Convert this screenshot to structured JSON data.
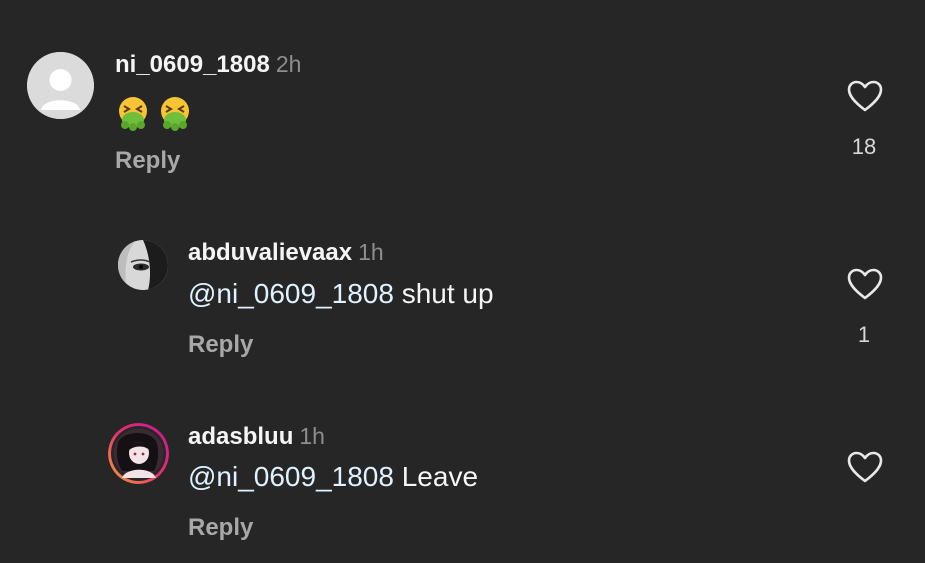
{
  "comments": [
    {
      "username": "ni_0609_1808",
      "time": "2h",
      "text": "🤮🤮",
      "reply_label": "Reply",
      "like_count": "18",
      "avatar_icon": "default-avatar-icon"
    },
    {
      "username": "abduvalievaax",
      "time": "1h",
      "mention": "@ni_0609_1808",
      "text": " shut up",
      "reply_label": "Reply",
      "like_count": "1",
      "avatar_icon": "user-photo-avatar"
    },
    {
      "username": "adasbluu",
      "time": "1h",
      "mention": "@ni_0609_1808",
      "text": " Leave",
      "reply_label": "Reply",
      "like_count": "",
      "avatar_icon": "story-ring-avatar"
    }
  ],
  "icons": {
    "like": "heart-outline-icon"
  },
  "colors": {
    "background": "#262626",
    "username": "#f5f5f5",
    "time": "#8e8e8e",
    "reply": "#a8a8a8",
    "mention": "#e0f1ff",
    "story_ring_start": "#f9a23a",
    "story_ring_end": "#c3179b"
  }
}
